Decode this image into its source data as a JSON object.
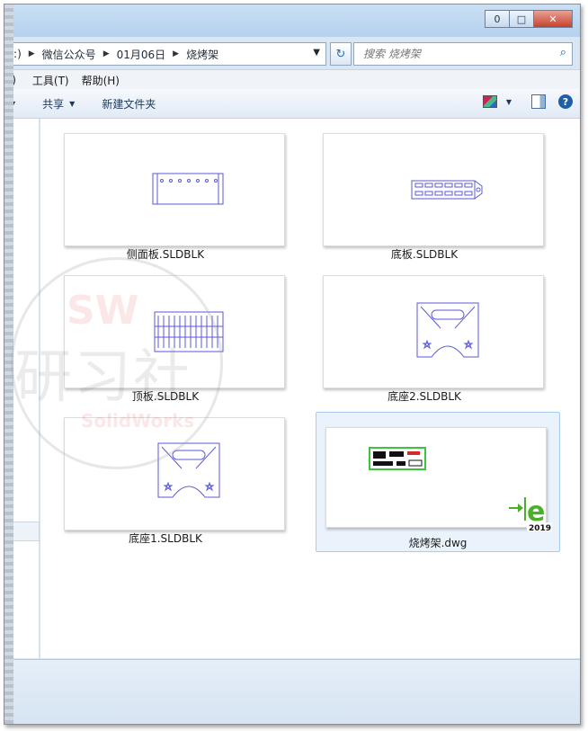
{
  "window": {
    "min": "0",
    "max": "□",
    "close": "✕"
  },
  "address": {
    "crumbs": [
      "H:)",
      "微信公众号",
      "01月06日",
      "烧烤架"
    ],
    "search_placeholder": "搜索 烧烤架"
  },
  "menu": {
    "view_fragment": "V)",
    "tools": "工具(T)",
    "help": "帮助(H)"
  },
  "toolbar": {
    "share": "共享",
    "new_folder": "新建文件夹"
  },
  "files": [
    {
      "name": "侧面板.SLDBLK"
    },
    {
      "name": "底板.SLDBLK"
    },
    {
      "name": "顶板.SLDBLK"
    },
    {
      "name": "底座2.SLDBLK"
    },
    {
      "name": "底座1.SLDBLK"
    },
    {
      "name": "烧烤架.dwg"
    }
  ],
  "badge": {
    "year": "2019",
    "letter": "e"
  },
  "watermark": {
    "sw": "SW",
    "cn": "研习社",
    "en": "SolidWorks"
  },
  "colors": {
    "accent": "#1f5fa8",
    "cad_line": "#5a5ad6",
    "dwg_green": "#3cc43c",
    "badge_green": "#4caf2a"
  }
}
